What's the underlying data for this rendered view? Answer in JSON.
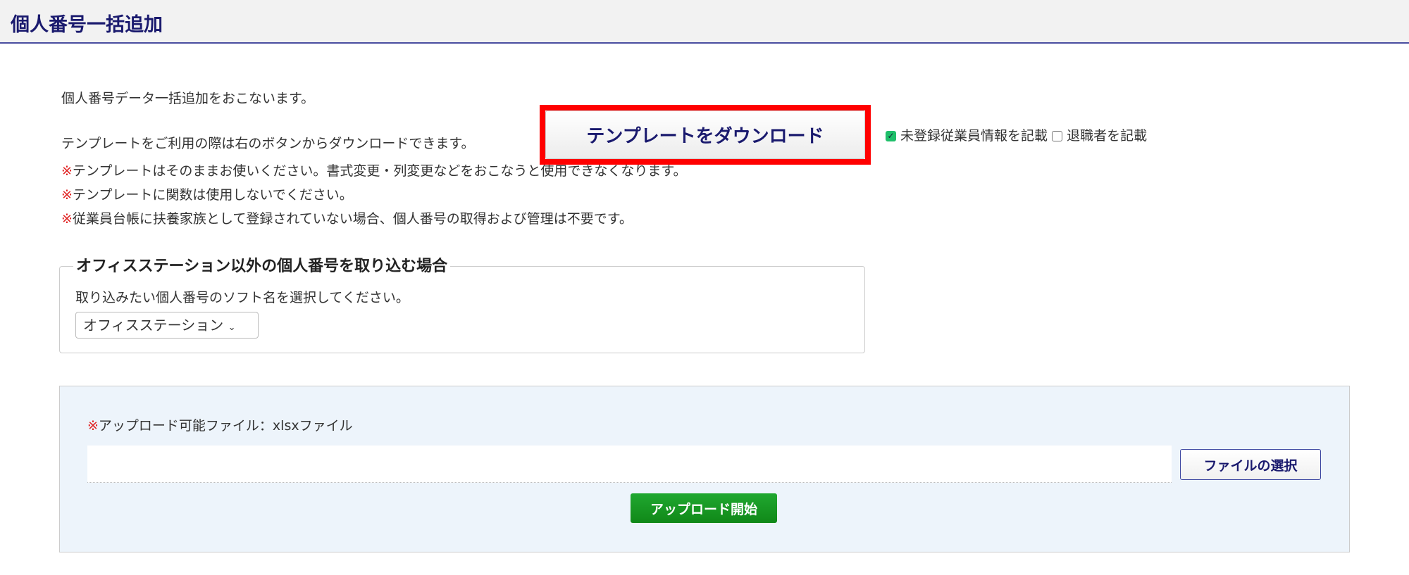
{
  "header": {
    "title": "個人番号一括追加"
  },
  "intro": {
    "line1": "個人番号データ一括追加をおこないます。",
    "line2": "テンプレートをご利用の際は右のボタンからダウンロードできます。",
    "notes": [
      {
        "mark": "※",
        "text": "テンプレートはそのままお使いください。書式変更・列変更などをおこなうと使用できなくなります。"
      },
      {
        "mark": "※",
        "text": "テンプレートに関数は使用しないでください。"
      },
      {
        "mark": "※",
        "text": "従業員台帳に扶養家族として登録されていない場合、個人番号の取得および管理は不要です。"
      }
    ]
  },
  "download_button": "テンプレートをダウンロード",
  "options": [
    {
      "label": "未登録従業員情報を記載",
      "checked": true
    },
    {
      "label": "退職者を記載",
      "checked": false
    }
  ],
  "import_section": {
    "legend": "オフィスステーション以外の個人番号を取り込む場合",
    "instruction": "取り込みたい個人番号のソフト名を選択してください。",
    "selected_software": "オフィスステーション"
  },
  "upload": {
    "note_mark": "※",
    "note": "アップロード可能ファイル：xlsxファイル",
    "file_value": "",
    "choose_file_button": "ファイルの選択",
    "upload_button": "アップロード開始"
  },
  "colors": {
    "highlight": "#ff0000",
    "primary": "#1a1a6e",
    "upload_green": "#18a028"
  }
}
